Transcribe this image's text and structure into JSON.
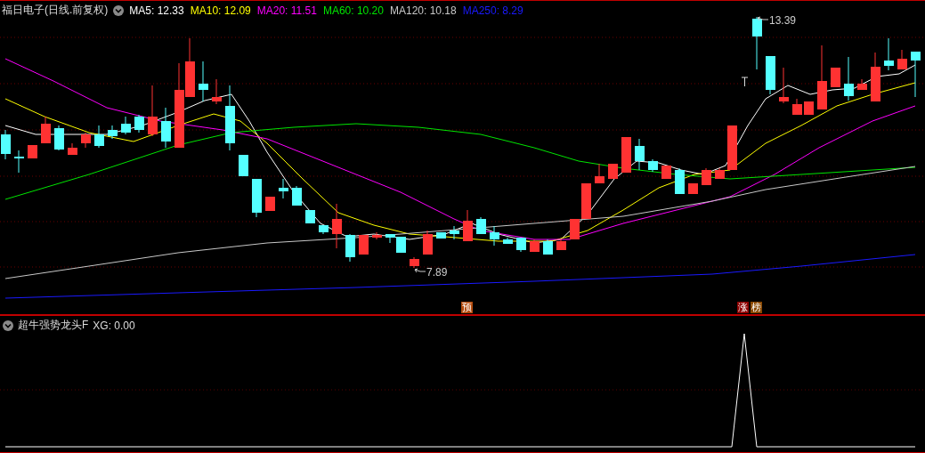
{
  "chart": {
    "title": "福日电子(日线.前复权)",
    "ma_legend": [
      {
        "text": "MA5: 12.33",
        "color": "#ffffff"
      },
      {
        "text": "MA10: 12.09",
        "color": "#ffff00"
      },
      {
        "text": "MA20: 11.51",
        "color": "#ff00ff"
      },
      {
        "text": "MA60: 10.20",
        "color": "#00e600"
      },
      {
        "text": "MA120: 10.18",
        "color": "#c8c8c8"
      },
      {
        "text": "MA250: 8.29",
        "color": "#1a1aff"
      }
    ],
    "annotations": [
      {
        "kind": "high",
        "text": "13.39"
      },
      {
        "kind": "low",
        "text": "7.89"
      }
    ],
    "badges": [
      {
        "text": "预",
        "color": "#b34a0c"
      },
      {
        "text": "涨",
        "color": "#8c0000"
      },
      {
        "text": "榜",
        "color": "#8a4800"
      }
    ]
  },
  "indicator": {
    "title": "超牛强势龙头F",
    "reading": "XG: 0.00"
  }
}
